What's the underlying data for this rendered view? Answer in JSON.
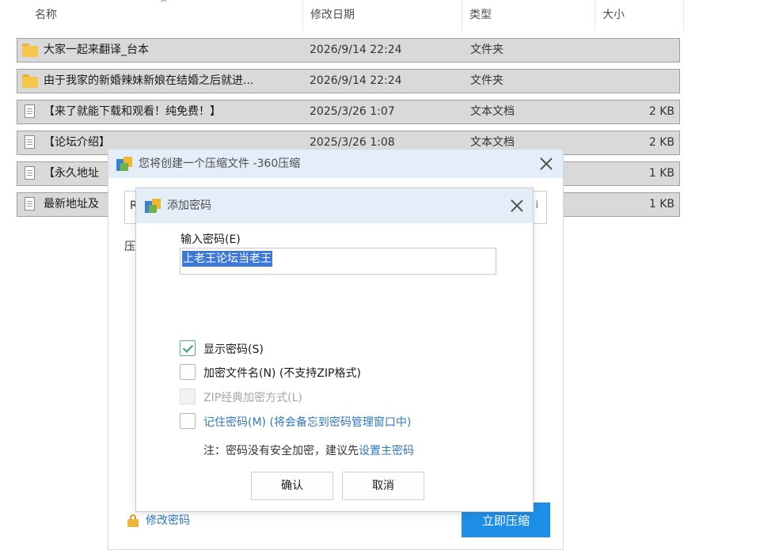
{
  "explorer": {
    "columns": {
      "name": "名称",
      "date": "修改日期",
      "type": "类型",
      "size": "大小"
    },
    "sort_indicator": "^",
    "rows": [
      {
        "icon": "folder-icon",
        "name": "大家一起来翻译_台本",
        "date": "2026/9/14 22:24",
        "type": "文件夹",
        "size": ""
      },
      {
        "icon": "folder-icon",
        "name": "由于我家的新婚辣妹新娘在结婚之后就进...",
        "date": "2026/9/14 22:24",
        "type": "文件夹",
        "size": ""
      },
      {
        "icon": "text-document-icon",
        "name": "【来了就能下载和观看！纯免费！】",
        "date": "2025/3/26 1:07",
        "type": "文本文档",
        "size": "2 KB"
      },
      {
        "icon": "text-document-icon",
        "name": "【论坛介绍】",
        "date": "2025/3/26 1:08",
        "type": "文本文档",
        "size": "2 KB"
      },
      {
        "icon": "text-document-icon",
        "name": "【永久地址",
        "date": "",
        "type": "",
        "size": "1 KB"
      },
      {
        "icon": "text-document-icon",
        "name": "最新地址及",
        "date": "",
        "type": "",
        "size": "1 KB"
      }
    ]
  },
  "compress_dialog": {
    "title": "您将创建一个压缩文件 -360压缩",
    "path_value": "R",
    "path_dropdown": "i",
    "compress_label": "压",
    "change_password": "修改密码",
    "start_button": "立即压缩",
    "accent_color": "#1e8fe8"
  },
  "password_dialog": {
    "title": "添加密码",
    "input_label": "输入密码(E)",
    "password_value": "上老王论坛当老王",
    "options": [
      {
        "label": "显示密码(S)",
        "checked": true,
        "enabled": true
      },
      {
        "label": "加密文件名(N) (不支持ZIP格式)",
        "checked": false,
        "enabled": true
      },
      {
        "label": "ZIP经典加密方式(L)",
        "checked": false,
        "enabled": false
      },
      {
        "label": "记住密码(M) (将会备忘到密码管理窗口中)",
        "checked": false,
        "enabled": true
      }
    ],
    "note_prefix": "注：密码没有安全加密，建议先",
    "note_link": "设置主密码",
    "ok_button": "确认",
    "cancel_button": "取消",
    "link_color": "#2f78c4",
    "selection_color": "#3b78d8"
  }
}
